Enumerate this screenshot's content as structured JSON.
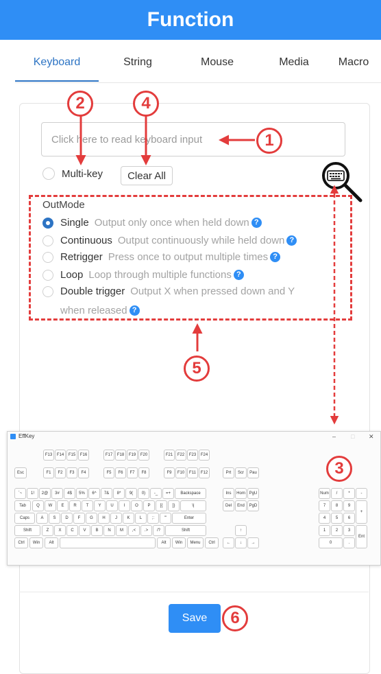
{
  "header": {
    "title": "Function"
  },
  "tabs": [
    {
      "label": "Keyboard",
      "active": true
    },
    {
      "label": "String",
      "active": false
    },
    {
      "label": "Mouse",
      "active": false
    },
    {
      "label": "Media",
      "active": false
    },
    {
      "label": "Macro",
      "active": false
    }
  ],
  "keyboard_input": {
    "placeholder": "Click here to read keyboard input",
    "value": ""
  },
  "multikey": {
    "label": "Multi-key",
    "checked": false
  },
  "clear_all": {
    "label": "Clear All"
  },
  "outmode": {
    "title": "OutMode",
    "options": [
      {
        "label": "Single",
        "description": "Output only once when held down",
        "checked": true
      },
      {
        "label": "Continuous",
        "description": "Output continuously while held down",
        "checked": false
      },
      {
        "label": "Retrigger",
        "description": "Press once to output multiple times",
        "checked": false
      },
      {
        "label": "Loop",
        "description": "Loop through multiple functions",
        "checked": false
      },
      {
        "label": "Double trigger",
        "description": "Output X when pressed down and Y",
        "description_cont": "when released",
        "checked": false
      }
    ]
  },
  "help_glyph": "?",
  "callouts": [
    "1",
    "2",
    "3",
    "4",
    "5",
    "6"
  ],
  "effkey": {
    "title": "EffKey",
    "controls": {
      "minimize": "–",
      "maximize": "□",
      "close": "✕"
    },
    "rows": {
      "f13": [
        "F13",
        "F14",
        "F15",
        "F16",
        "F17",
        "F18",
        "F19",
        "F20",
        "F21",
        "F22",
        "F23",
        "F24"
      ],
      "f1": [
        "Esc",
        "F1",
        "F2",
        "F3",
        "F4",
        "F5",
        "F6",
        "F7",
        "F8",
        "F9",
        "F10",
        "F11",
        "F12",
        "Prt",
        "Scr",
        "Pau"
      ],
      "num": [
        "`~",
        "1!",
        "2@",
        "3#",
        "4$",
        "5%",
        "6^",
        "7&",
        "8*",
        "9(",
        "0)",
        "-_",
        "=+",
        "Backspace",
        "Ins",
        "Hom",
        "PgU",
        "Num",
        "/",
        "*",
        "-"
      ],
      "tab": [
        "Tab",
        "Q",
        "W",
        "E",
        "R",
        "T",
        "Y",
        "U",
        "I",
        "O",
        "P",
        "[{",
        "]}",
        "\\|",
        "Del",
        "End",
        "PgD",
        "7",
        "8",
        "9",
        "+"
      ],
      "caps": [
        "Caps",
        "A",
        "S",
        "D",
        "F",
        "G",
        "H",
        "J",
        "K",
        "L",
        ";:",
        "'\"",
        "Enter",
        "4",
        "5",
        "6"
      ],
      "shift": [
        "Shift",
        "Z",
        "X",
        "C",
        "V",
        "B",
        "N",
        "M",
        ",<",
        ".>",
        "/?",
        "Shift",
        "↑",
        "1",
        "2",
        "3",
        "Ent"
      ],
      "ctrl": [
        "Ctrl",
        "Win",
        "Alt",
        "",
        "Alt",
        "Win",
        "Menu",
        "Ctrl",
        "←",
        "↓",
        "→",
        "0",
        "."
      ]
    }
  },
  "save": {
    "label": "Save"
  },
  "colors": {
    "accent": "#2f8ef5",
    "annotation": "#e33c3c",
    "active_tab": "#2d74c4"
  },
  "icons": {
    "keyboard": "keyboard-icon",
    "magnifier": "magnifier-icon",
    "help": "help-icon"
  }
}
